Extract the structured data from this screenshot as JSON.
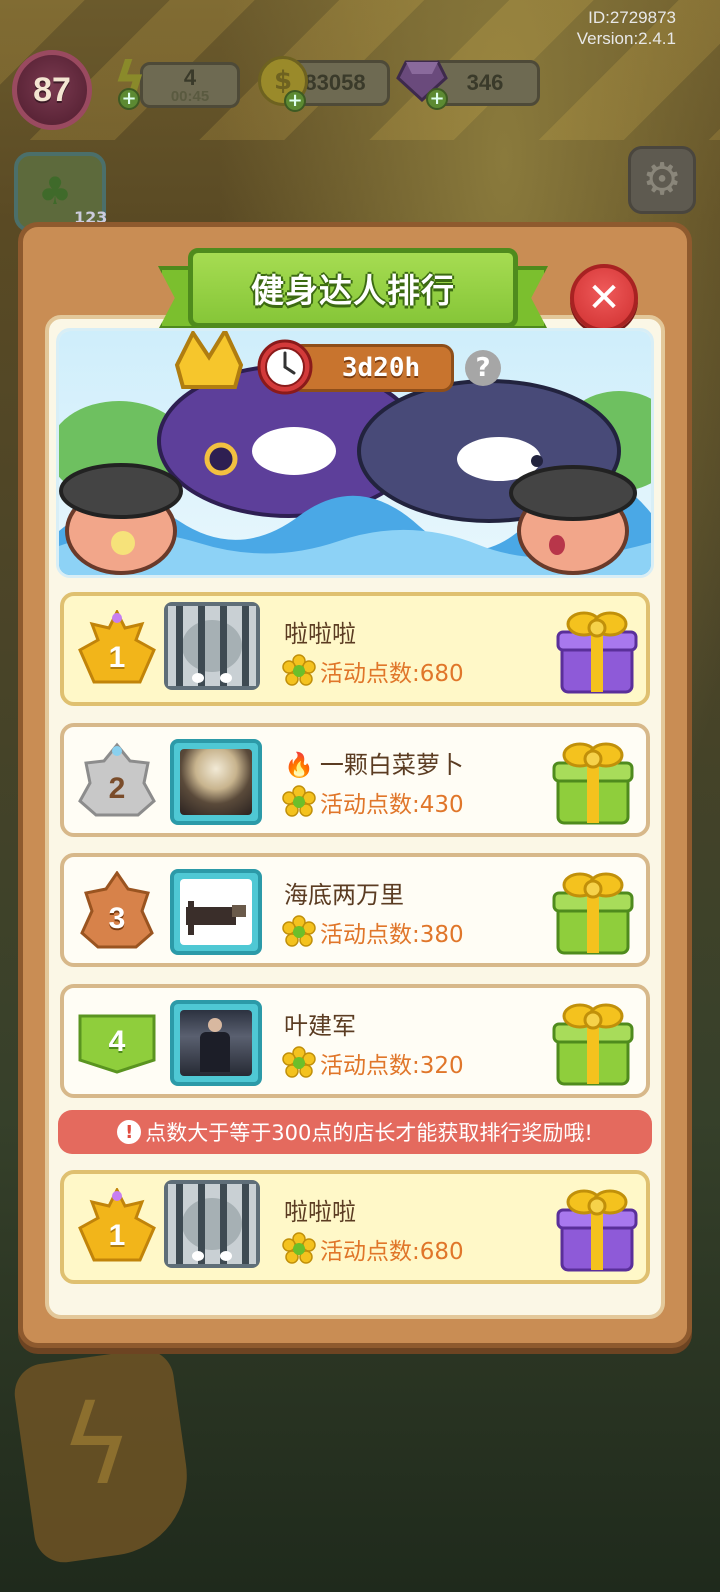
{
  "hud": {
    "id": "ID:2729873",
    "version": "Version:2.4.1",
    "level": "87",
    "energy": "4",
    "energy_timer": "00:45",
    "coins": "83058",
    "gems": "346"
  },
  "background": {
    "side_count": "123"
  },
  "panel": {
    "title": "健身达人排行",
    "timer": "3d20h",
    "help": "?",
    "close": "✕",
    "notice": "点数大于等于300点的店长才能获取排行奖励哦!"
  },
  "ranking": [
    {
      "rank": "1",
      "name": "啦啦啦",
      "points": "活动点数:680",
      "has_fire": false,
      "avatar": "cage",
      "gift": "purple"
    },
    {
      "rank": "2",
      "name": "一颗白菜萝卜",
      "points": "活动点数:430",
      "has_fire": true,
      "avatar": "photo-woman",
      "gift": "green"
    },
    {
      "rank": "3",
      "name": "海底两万里",
      "points": "活动点数:380",
      "has_fire": false,
      "avatar": "photo-pixel",
      "gift": "green"
    },
    {
      "rank": "4",
      "name": "叶建军",
      "points": "活动点数:320",
      "has_fire": false,
      "avatar": "photo-man",
      "gift": "green"
    }
  ],
  "self_entry": {
    "rank": "1",
    "name": "啦啦啦",
    "points": "活动点数:680",
    "avatar": "cage",
    "gift": "purple"
  },
  "colors": {
    "panel": "#c98d54",
    "ribbon": "#86c638",
    "close": "#d73a3a",
    "points": "#e0762a",
    "notice": "#e46a5e",
    "gold_badge": "#f2b51a",
    "silver_badge": "#b9b9b9",
    "bronze_badge": "#d7824a",
    "green_badge": "#8fce3c"
  },
  "icons": {
    "level": "level-badge",
    "energy": "lightning-icon",
    "coin": "coin-icon",
    "gem": "gem-icon",
    "settings": "gear-icon",
    "clock": "clock-icon",
    "help": "question-icon",
    "close": "close-icon",
    "points": "flower-icon",
    "reward": "gift-icon",
    "fire": "fire-icon",
    "notice": "exclamation-icon"
  }
}
